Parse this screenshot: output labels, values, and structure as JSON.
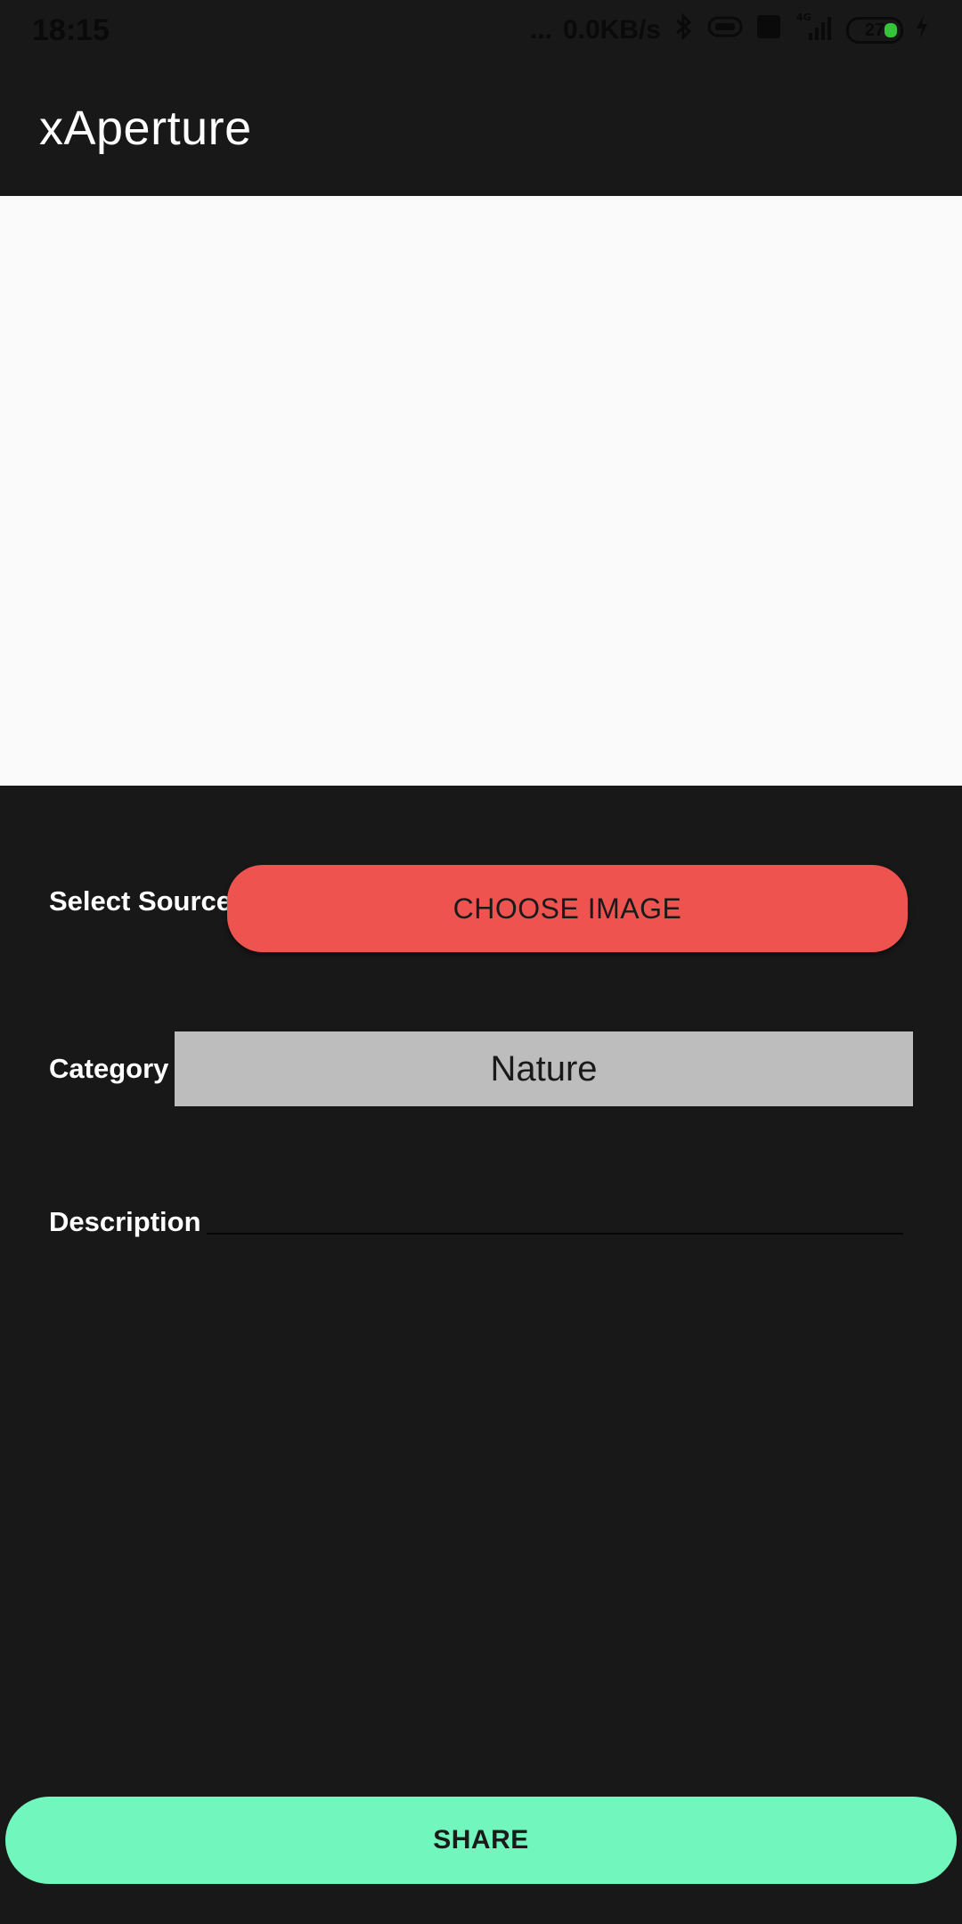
{
  "status_bar": {
    "time": "18:15",
    "dots": "...",
    "network_speed": "0.0KB/s",
    "network_type": "4G",
    "battery": "27"
  },
  "app_bar": {
    "title": "xAperture"
  },
  "form": {
    "source_label": "Select Source",
    "choose_image_label": "CHOOSE IMAGE",
    "category_label": "Category",
    "category_value": "Nature",
    "description_label": "Description",
    "description_value": ""
  },
  "actions": {
    "share_label": "SHARE"
  },
  "colors": {
    "background": "#181818",
    "preview": "#fafafa",
    "choose_button": "#ef5350",
    "category_box": "#bdbdbd",
    "share_button": "#71f7bd"
  }
}
